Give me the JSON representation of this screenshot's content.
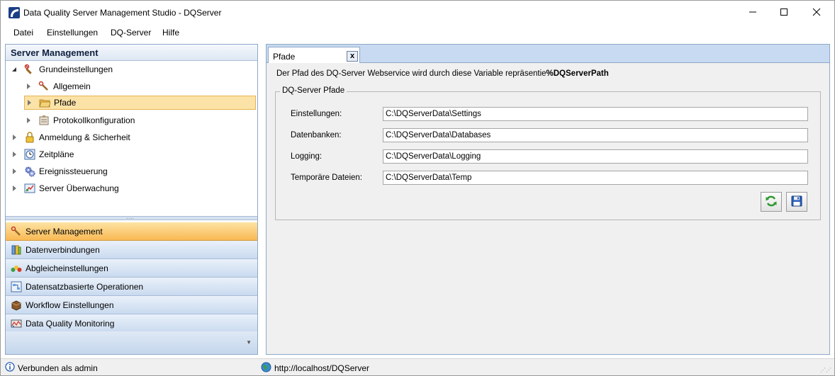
{
  "window": {
    "title": "Data Quality Server Management Studio - DQServer",
    "minimize_icon": "minimize-icon",
    "maximize_icon": "maximize-icon",
    "close_icon": "close-icon"
  },
  "menu": {
    "items": [
      "Datei",
      "Einstellungen",
      "DQ-Server",
      "Hilfe"
    ]
  },
  "left_panel": {
    "header": "Server Management",
    "tree": [
      {
        "label": "Grundeinstellungen",
        "icon": "wrench-icon",
        "expanded": true
      },
      {
        "label": "Allgemein",
        "icon": "wrench-icon"
      },
      {
        "label": "Pfade",
        "icon": "folder-icon",
        "selected": true
      },
      {
        "label": "Protokollkonfiguration",
        "icon": "log-icon"
      },
      {
        "label": "Anmeldung & Sicherheit",
        "icon": "lock-icon"
      },
      {
        "label": "Zeitpläne",
        "icon": "clock-icon"
      },
      {
        "label": "Ereignissteuerung",
        "icon": "gears-icon"
      },
      {
        "label": "Server Überwachung",
        "icon": "monitor-icon"
      }
    ],
    "nav_buttons": [
      {
        "label": "Server Management",
        "icon": "wrench-icon",
        "active": true
      },
      {
        "label": "Datenverbindungen",
        "icon": "database-icon"
      },
      {
        "label": "Abgleicheinstellungen",
        "icon": "match-icon"
      },
      {
        "label": "Datensatzbasierte Operationen",
        "icon": "records-icon"
      },
      {
        "label": "Workflow Einstellungen",
        "icon": "workflow-icon"
      },
      {
        "label": "Data Quality Monitoring",
        "icon": "monitoring-icon"
      }
    ]
  },
  "right_panel": {
    "tab": {
      "label": "Pfade",
      "close": "x"
    },
    "info_text": "Der Pfad des DQ-Server Webservice wird durch diese Variable repräsentie",
    "info_var": "%DQServerPath",
    "group_title": "DQ-Server Pfade",
    "fields": [
      {
        "label": "Einstellungen:",
        "value": "C:\\DQServerData\\Settings"
      },
      {
        "label": "Datenbanken:",
        "value": "C:\\DQServerData\\Databases"
      },
      {
        "label": "Logging:",
        "value": "C:\\DQServerData\\Logging"
      },
      {
        "label": "Temporäre Dateien:",
        "value": "C:\\DQServerData\\Temp"
      }
    ],
    "buttons": {
      "refresh_icon": "refresh-icon",
      "save_icon": "save-icon"
    }
  },
  "status": {
    "left": "Verbunden als admin",
    "right": "http://localhost/DQServer"
  },
  "colors": {
    "panel_border": "#8fa8c8",
    "tab_strip": "#c8daf1",
    "active_nav": "#f9b954",
    "selected_tree": "#fbe3a8"
  }
}
